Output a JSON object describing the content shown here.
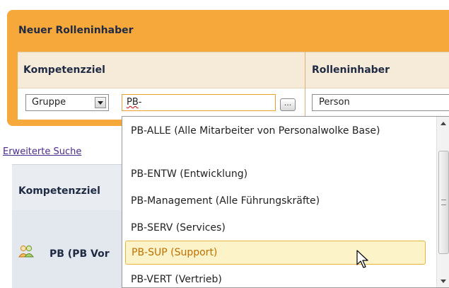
{
  "panel": {
    "title": "Neuer Rolleninhaber",
    "col_competence": "Kompetenzziel",
    "col_owner": "Rolleninhaber",
    "type_select": {
      "selected": "Gruppe"
    },
    "search_input": {
      "value": "PB-",
      "spell_part": "PB",
      "rest_part": "-"
    },
    "browse_button_label": "...",
    "owner_input": {
      "value": "Person"
    }
  },
  "advanced_search_link": "Erweiterte Suche",
  "results": {
    "header": "Kompetenzziel",
    "row_label": "PB (PB Vor",
    "row_icon": "group-icon"
  },
  "dropdown": {
    "items": [
      "PB-ALLE (Alle Mitarbeiter von Personalwolke Base)",
      "PB-ENTW (Entwicklung)",
      "PB-Management (Alle Führungskräfte)",
      "PB-SERV (Services)",
      "PB-SUP (Support)",
      "PB-VERT (Vertrieb)"
    ],
    "selected_index": 4
  },
  "colors": {
    "panel_orange": "#f7a83a",
    "header_text": "#1f2a44",
    "selected_bg": "#fdf3c8",
    "selected_text": "#c07000",
    "link": "#4a2b8e"
  }
}
